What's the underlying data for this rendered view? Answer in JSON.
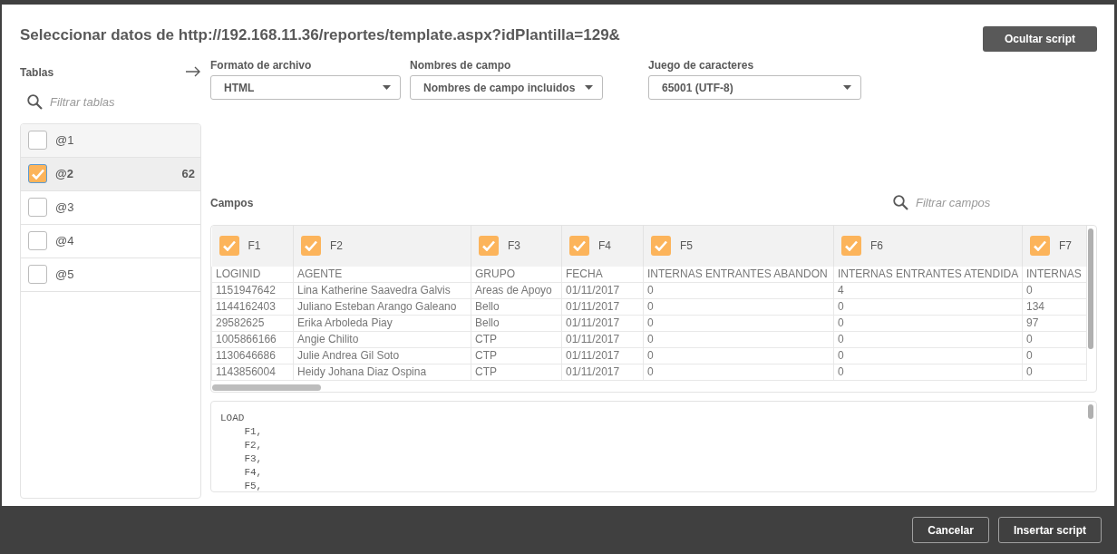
{
  "dialog": {
    "title": "Seleccionar datos de http://192.168.11.36/reportes/template.aspx?idPlantilla=129&",
    "toggle_button": "Ocultar script"
  },
  "tables_panel": {
    "label": "Tablas",
    "search": {
      "placeholder": "Filtrar tablas"
    },
    "items": [
      {
        "name": "@1",
        "checked": false,
        "selected": false
      },
      {
        "name": "@2",
        "checked": true,
        "selected": true,
        "count": "62"
      },
      {
        "name": "@3",
        "checked": false,
        "selected": false
      },
      {
        "name": "@4",
        "checked": false,
        "selected": false
      },
      {
        "name": "@5",
        "checked": false,
        "selected": false
      }
    ]
  },
  "options": [
    {
      "label": "Formato de archivo",
      "value": "HTML"
    },
    {
      "label": "Nombres de campo",
      "value": "Nombres de campo incluidos"
    },
    {
      "label": "Juego de caracteres",
      "value": "65001 (UTF-8)"
    }
  ],
  "fields": {
    "label": "Campos",
    "search": {
      "placeholder": "Filtrar campos"
    },
    "columns": [
      {
        "name": "F1",
        "checked": true
      },
      {
        "name": "F2",
        "checked": true
      },
      {
        "name": "F3",
        "checked": true
      },
      {
        "name": "F4",
        "checked": true
      },
      {
        "name": "F5",
        "checked": true
      },
      {
        "name": "F6",
        "checked": true
      },
      {
        "name": "F7",
        "checked": true
      }
    ],
    "rows": [
      [
        "LOGINID",
        "AGENTE",
        "GRUPO",
        "FECHA",
        "INTERNAS ENTRANTES ABANDON",
        "INTERNAS ENTRANTES ATENDIDA",
        "INTERNAS"
      ],
      [
        "1151947642",
        "Lina Katherine Saavedra Galvis",
        "Areas de Apoyo",
        "01/11/2017",
        "0",
        "4",
        "0"
      ],
      [
        "1144162403",
        "Juliano Esteban Arango Galeano",
        "Bello",
        "01/11/2017",
        "0",
        "0",
        "134"
      ],
      [
        "29582625",
        "Erika Arboleda Piay",
        "Bello",
        "01/11/2017",
        "0",
        "0",
        "97"
      ],
      [
        "1005866166",
        "Angie Chilito",
        "CTP",
        "01/11/2017",
        "0",
        "0",
        "0"
      ],
      [
        "1130646686",
        "Julie Andrea Gil Soto",
        "CTP",
        "01/11/2017",
        "0",
        "0",
        "0"
      ],
      [
        "1143856004",
        "Heidy Johana Diaz Ospina",
        "CTP",
        "01/11/2017",
        "0",
        "0",
        "0"
      ]
    ]
  },
  "script": {
    "lines": [
      "LOAD",
      "    F1,",
      "    F2,",
      "    F3,",
      "    F4,",
      "    F5,"
    ]
  },
  "buttons": [
    "Cancelar",
    "Insertar script"
  ]
}
